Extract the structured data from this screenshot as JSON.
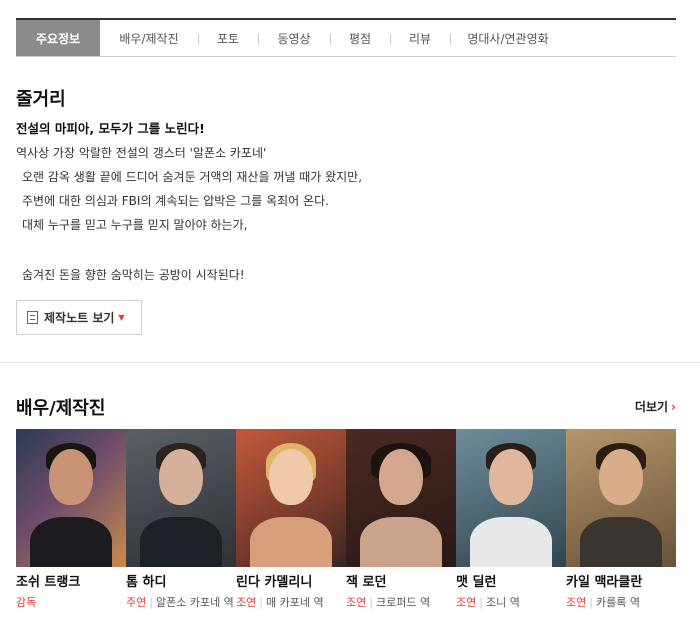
{
  "tabs": [
    {
      "label": "주요정보",
      "active": true
    },
    {
      "label": "배우/제작진",
      "active": false
    },
    {
      "label": "포토",
      "active": false
    },
    {
      "label": "동영상",
      "active": false
    },
    {
      "label": "평점",
      "active": false
    },
    {
      "label": "리뷰",
      "active": false
    },
    {
      "label": "명대사/연관영화",
      "active": false
    }
  ],
  "synopsis": {
    "title": "줄거리",
    "headline": "전설의 마피아, 모두가 그를 노린다!",
    "lines": [
      "역사상 가장 악랄한 전설의 갱스터 '알폰소 카포네'",
      "오랜 감옥 생활 끝에 드디어 숨겨둔 거액의 재산을 꺼낼 때가 왔지만,",
      "주변에 대한 의심과 FBI의 계속되는 압박은 그를 옥죄어 온다.",
      "대체 누구를 믿고 누구를 믿지 말아야 하는가,",
      "숨겨진 돈을 향한 숨막히는 공방이 시작된다!"
    ],
    "note_button": "제작노트 보기"
  },
  "cast_section": {
    "title": "배우/제작진",
    "more_label": "더보기",
    "members": [
      {
        "name": "조쉬 트랭크",
        "kind": "감독",
        "role": ""
      },
      {
        "name": "톰 하디",
        "kind": "주연",
        "role": "알폰소 카포네 역"
      },
      {
        "name": "린다 카델리니",
        "kind": "조연",
        "role": "매 카포네 역"
      },
      {
        "name": "잭 로던",
        "kind": "조연",
        "role": "크로퍼드 역"
      },
      {
        "name": "맷 딜런",
        "kind": "조연",
        "role": "조니 역"
      },
      {
        "name": "카일 맥라클란",
        "kind": "조연",
        "role": "카를록 역"
      }
    ]
  },
  "colors": {
    "accent": "#e03b3b",
    "active_tab": "#8b8b8b"
  }
}
